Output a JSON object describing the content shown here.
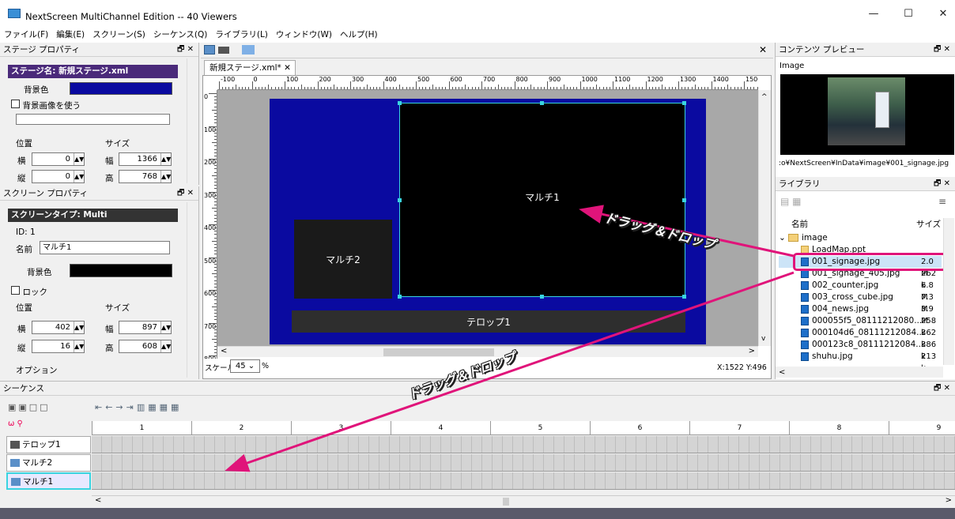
{
  "app": {
    "title": "NextScreen MultiChannel Edition -- 40 Viewers",
    "min": "—",
    "max": "☐",
    "close": "✕"
  },
  "menu": [
    "ファイル(F)",
    "編集(E)",
    "スクリーン(S)",
    "シーケンス(Q)",
    "ライブラリ(L)",
    "ウィンドウ(W)",
    "ヘルプ(H)"
  ],
  "stage_props": {
    "title": "ステージ プロパティ",
    "pin": "🗗 ✕",
    "name_label": "ステージ名: 新規ステージ.xml",
    "bg_label": "背景色",
    "bg_color": "#0a0aa0",
    "use_bg_image": "背景画像を使う",
    "pos_label": "位置",
    "size_label": "サイズ",
    "x_label": "横",
    "y_label": "縦",
    "w_label": "幅",
    "h_label": "高",
    "x": "0",
    "y": "0",
    "w": "1366",
    "h": "768"
  },
  "screen_props": {
    "title": "スクリーン プロパティ",
    "pin": "🗗 ✕",
    "type_label": "スクリーンタイプ: Multi",
    "id": "ID: 1",
    "name_label": "名前",
    "name": "マルチ1",
    "bg_label": "背景色",
    "bg_color": "#000000",
    "lock": "ロック",
    "pos_label": "位置",
    "size_label": "サイズ",
    "x_label": "横",
    "y_label": "縦",
    "w_label": "幅",
    "h_label": "高",
    "x": "402",
    "y": "16",
    "w": "897",
    "h": "608",
    "option": "オプション"
  },
  "editor": {
    "tab": "新規ステージ.xml*",
    "tab_close": "✕",
    "close": "✕",
    "ruler_h": [
      "-100",
      "0",
      "100",
      "200",
      "300",
      "400",
      "500",
      "600",
      "700",
      "800",
      "900",
      "1000",
      "1100",
      "1200",
      "1300",
      "1400",
      "1500"
    ],
    "ruler_v": [
      "0",
      "100",
      "200",
      "300",
      "400",
      "500",
      "600",
      "700",
      "800"
    ],
    "screen_multi1": "マルチ1",
    "screen_multi2": "マルチ2",
    "screen_telop": "テロップ1",
    "scale_label": "スケール",
    "scale": "45",
    "scale_unit": "%",
    "coords": "X:1522  Y:496"
  },
  "preview": {
    "title": "コンテンツ プレビュー",
    "pin": "🗗 ✕",
    "label": "Image",
    "path": ":o¥NextScreen¥InData¥image¥001_signage.jpg"
  },
  "library": {
    "title": "ライブラリ",
    "pin": "🗗 ✕",
    "col_name": "名前",
    "col_size": "サイズ",
    "folder": "image",
    "items": [
      {
        "name": "LoadMap.ppt",
        "size": ""
      },
      {
        "name": "001_signage.jpg",
        "size": "2.0 M"
      },
      {
        "name": "001_signage_405.jpg",
        "size": "262 k"
      },
      {
        "name": "002_counter.jpg",
        "size": "6.8 M"
      },
      {
        "name": "003_cross_cube.jpg",
        "size": "7.3 M"
      },
      {
        "name": "004_news.jpg",
        "size": "3.9 M"
      },
      {
        "name": "000055f5_08111212080...",
        "size": "258 k"
      },
      {
        "name": "000104d6_08111212084...",
        "size": "362 k"
      },
      {
        "name": "000123c8_08111212084...",
        "size": "386 k"
      },
      {
        "name": "shuhu.jpg",
        "size": "213 k"
      }
    ]
  },
  "sequence": {
    "title": "シーケンス",
    "pin": "🗗 ✕",
    "columns": [
      "1",
      "2",
      "3",
      "4",
      "5",
      "6",
      "7",
      "8",
      "9"
    ],
    "tracks": [
      "テロップ1",
      "マルチ2",
      "マルチ1"
    ]
  },
  "annotations": {
    "drag1": "ドラッグ＆ドロップ",
    "drag2": "ドラッグ＆ドロップ",
    "accent": "#e0147a"
  }
}
